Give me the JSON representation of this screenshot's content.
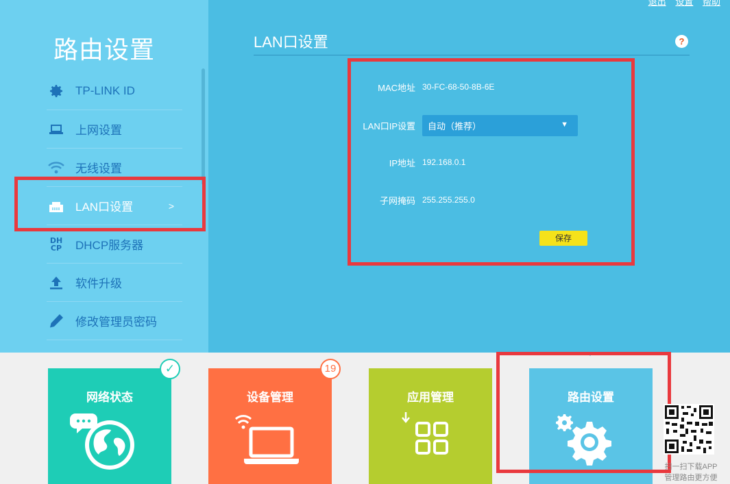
{
  "top_links": [
    "退出",
    "设置",
    "帮助"
  ],
  "sidebar": {
    "title": "路由设置",
    "items": [
      {
        "label": "TP-LINK ID",
        "icon": "gear-icon"
      },
      {
        "label": "上网设置",
        "icon": "laptop-icon"
      },
      {
        "label": "无线设置",
        "icon": "wifi-icon"
      },
      {
        "label": "LAN口设置",
        "icon": "lan-port-icon",
        "active": true,
        "arrow": ">"
      },
      {
        "label": "DHCP服务器",
        "icon": "dhcp-icon",
        "icon_text": [
          "DH",
          "CP"
        ]
      },
      {
        "label": "软件升级",
        "icon": "upload-icon"
      },
      {
        "label": "修改管理员密码",
        "icon": "pencil-icon"
      }
    ]
  },
  "main": {
    "title": "LAN口设置",
    "help": "?",
    "fields": {
      "mac_label": "MAC地址",
      "mac_value": "30-FC-68-50-8B-6E",
      "lanip_label": "LAN口IP设置",
      "lanip_value": "自动（推荐）",
      "ip_label": "IP地址",
      "ip_value": "192.168.0.1",
      "mask_label": "子网掩码",
      "mask_value": "255.255.255.0"
    },
    "save_label": "保存"
  },
  "tiles": [
    {
      "title": "网络状态",
      "color": "#1ecdb6",
      "badge": "✓"
    },
    {
      "title": "设备管理",
      "color": "#ff7043",
      "badge": "19"
    },
    {
      "title": "应用管理",
      "color": "#b5cd2f"
    },
    {
      "title": "路由设置",
      "color": "#5ac4e6"
    }
  ],
  "qr": {
    "line1": "扫一扫下载APP",
    "line2": "管理路由更方便"
  },
  "colors": {
    "highlight": "#e9393e",
    "save": "#f5e21a",
    "sidebar": "#6dd0f0",
    "panel": "#4bbde3"
  }
}
